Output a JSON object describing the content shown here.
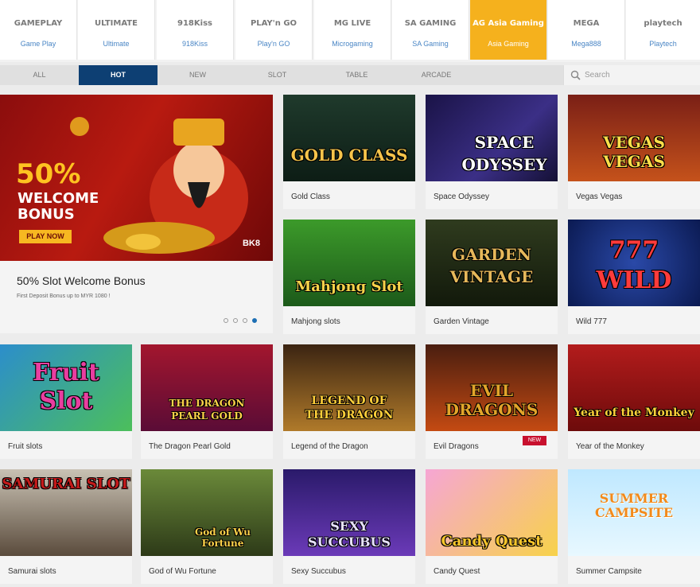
{
  "providers": [
    {
      "logo": "GAMEPLAY",
      "label": "Game Play"
    },
    {
      "logo": "ULTIMATE",
      "label": "Ultimate"
    },
    {
      "logo": "918Kiss",
      "label": "918Kiss"
    },
    {
      "logo": "PLAY'n GO",
      "label": "Play'n GO"
    },
    {
      "logo": "MG LIVE",
      "label": "Microgaming"
    },
    {
      "logo": "SA GAMING",
      "label": "SA Gaming"
    },
    {
      "logo": "AG Asia Gaming",
      "label": "Asia Gaming"
    },
    {
      "logo": "MEGA",
      "label": "Mega888"
    },
    {
      "logo": "playtech",
      "label": "Playtech"
    }
  ],
  "active_provider": "Asia Gaming",
  "tabs": [
    "ALL",
    "HOT",
    "NEW",
    "SLOT",
    "TABLE",
    "ARCADE"
  ],
  "active_tab": "HOT",
  "search": {
    "placeholder": "Search"
  },
  "banner": {
    "percent": "50%",
    "line1": "WELCOME",
    "line2": "BONUS",
    "cta": "PLAY NOW",
    "brand": "BK8",
    "title": "50% Slot Welcome Bonus",
    "subtitle": "First Deposit Bonus up to MYR 1080 !",
    "slides": 4,
    "active_slide": 4
  },
  "games": [
    {
      "name": "Gold Class",
      "art": "GOLD CLASS"
    },
    {
      "name": "Space Odyssey",
      "art": "SPACE ODYSSEY"
    },
    {
      "name": "Vegas Vegas",
      "art": "VEGAS VEGAS"
    },
    {
      "name": "Mahjong slots",
      "art": "Mahjong Slot"
    },
    {
      "name": "Garden Vintage",
      "art": "GARDEN VINTAGE"
    },
    {
      "name": "Wild 777",
      "art": "777 WILD"
    },
    {
      "name": "Fruit slots",
      "art": "Fruit Slot"
    },
    {
      "name": "The Dragon Pearl Gold",
      "art": "THE DRAGON PEARL GOLD"
    },
    {
      "name": "Legend of the Dragon",
      "art": "LEGEND OF THE DRAGON"
    },
    {
      "name": "Evil Dragons",
      "art": "EVIL DRAGONS",
      "badge": "NEW"
    },
    {
      "name": "Year of the Monkey",
      "art": "Year of the Monkey"
    },
    {
      "name": "Samurai slots",
      "art": "SAMURAI SLOT"
    },
    {
      "name": "God of Wu Fortune",
      "art": "God of Wu Fortune"
    },
    {
      "name": "Sexy Succubus",
      "art": "SEXY SUCCUBUS"
    },
    {
      "name": "Candy Quest",
      "art": "Candy Quest"
    },
    {
      "name": "Summer Campsite",
      "art": "SUMMER CAMPSITE"
    }
  ],
  "colors": {
    "active_tab": "#0d3f73",
    "active_provider": "#f5b11d",
    "link": "#4a86c5",
    "badge": "#c8102e"
  }
}
